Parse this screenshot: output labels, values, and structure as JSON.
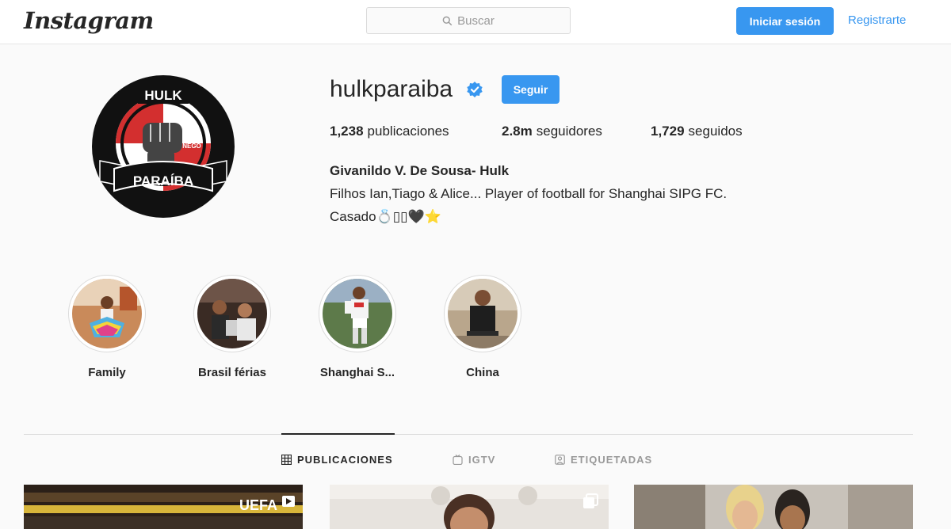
{
  "nav": {
    "logo": "Instagram",
    "search_placeholder": "Buscar",
    "login_label": "Iniciar sesión",
    "register_label": "Registrarte"
  },
  "profile": {
    "username": "hulkparaiba",
    "verified": true,
    "follow_label": "Seguir",
    "avatar_text_top": "HULK",
    "avatar_text_bottom": "PARAÍBA",
    "avatar_text_small": "NEGO",
    "stats": [
      {
        "value": "1,238",
        "label": "publicaciones"
      },
      {
        "value": "2.8m",
        "label": "seguidores"
      },
      {
        "value": "1,729",
        "label": "seguidos"
      }
    ],
    "full_name": "Givanildo V. De Sousa- Hulk",
    "bio_line1": "Filhos Ian,Tiago & Alice... Player of football for Shanghai SIPG FC.",
    "bio_line2": "Casado💍▯▯🖤⭐"
  },
  "highlights": [
    {
      "label": "Family"
    },
    {
      "label": "Brasil férias"
    },
    {
      "label": "Shanghai S..."
    },
    {
      "label": "China"
    }
  ],
  "tabs": [
    {
      "label": "PUBLICACIONES",
      "icon": "grid-icon",
      "active": true
    },
    {
      "label": "IGTV",
      "icon": "igtv-icon",
      "active": false
    },
    {
      "label": "ETIQUETADAS",
      "icon": "tagged-icon",
      "active": false
    }
  ],
  "posts": [
    {
      "overlay_text": "UEFA",
      "badge_icon": "video-icon"
    },
    {
      "overlay_text": "",
      "badge_icon": "carousel-icon"
    },
    {
      "overlay_text": "",
      "badge_icon": ""
    }
  ],
  "colors": {
    "accent": "#3897f0",
    "background": "#fafafa",
    "text": "#262626",
    "avatar_red": "#d32f2f"
  }
}
